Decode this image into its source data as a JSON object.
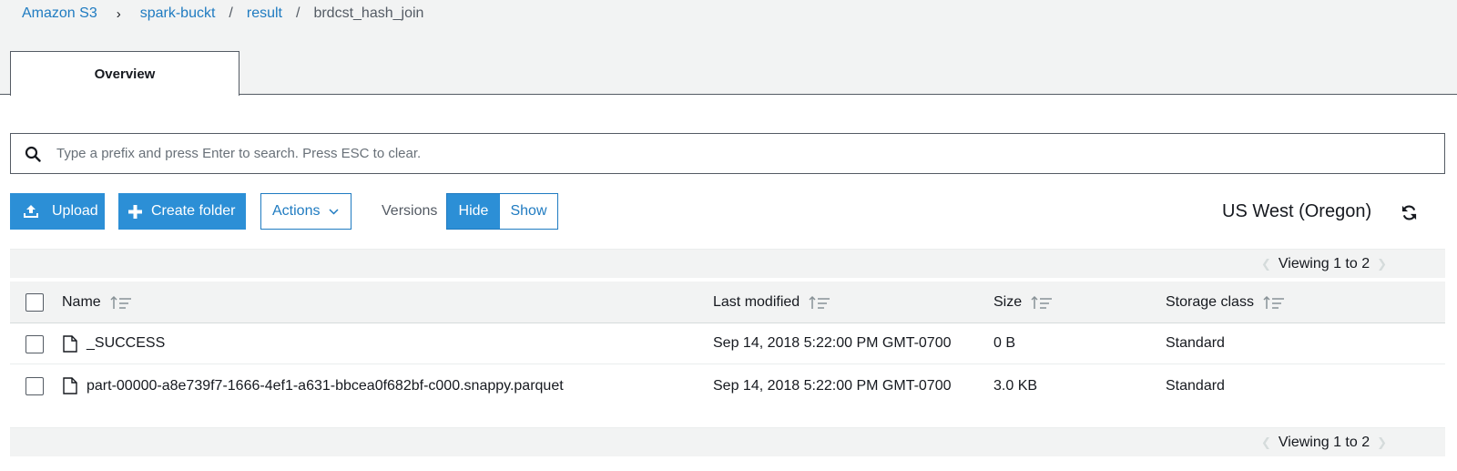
{
  "breadcrumb": {
    "root": "Amazon S3",
    "bucket": "spark-buckt",
    "folder": "result",
    "current": "brdcst_hash_join",
    "sep": "/",
    "chevron": "›"
  },
  "tabs": {
    "overview": "Overview"
  },
  "search": {
    "placeholder": "Type a prefix and press Enter to search. Press ESC to clear.",
    "value": ""
  },
  "toolbar": {
    "upload": "Upload",
    "create_folder": "Create folder",
    "actions": "Actions",
    "versions_label": "Versions",
    "hide": "Hide",
    "show": "Show"
  },
  "region": "US West (Oregon)",
  "pager": {
    "top": "Viewing 1 to 2",
    "bottom": "Viewing 1 to 2"
  },
  "table": {
    "columns": {
      "name": "Name",
      "last_modified": "Last modified",
      "size": "Size",
      "storage_class": "Storage class"
    },
    "rows": [
      {
        "name": "_SUCCESS",
        "last_modified": "Sep 14, 2018 5:22:00 PM GMT-0700",
        "size": "0 B",
        "storage_class": "Standard"
      },
      {
        "name": "part-00000-a8e739f7-1666-4ef1-a631-bbcea0f682bf-c000.snappy.parquet",
        "last_modified": "Sep 14, 2018 5:22:00 PM GMT-0700",
        "size": "3.0 KB",
        "storage_class": "Standard"
      }
    ]
  },
  "colors": {
    "link": "#1f7bc1",
    "primary": "#2c8fd6",
    "header_bg": "#f2f3f3"
  },
  "icons": [
    "search-icon",
    "upload-icon",
    "plus-icon",
    "chevron-down-icon",
    "refresh-icon",
    "sort-icon",
    "file-icon"
  ]
}
